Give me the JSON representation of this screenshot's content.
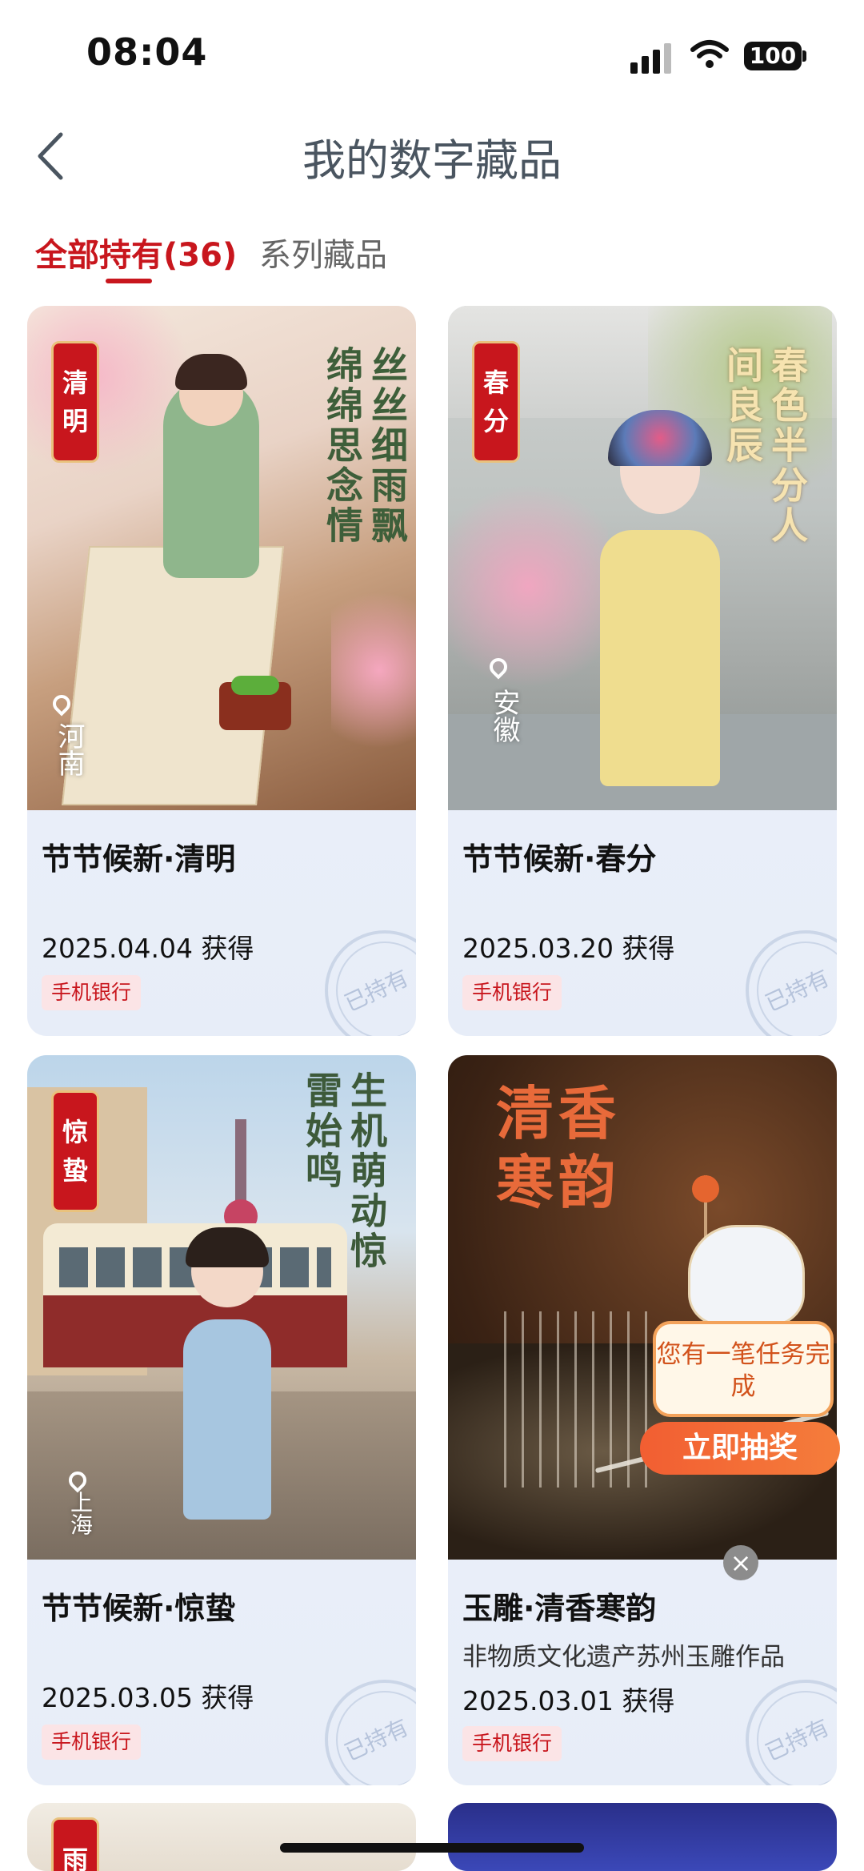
{
  "status_bar": {
    "time": "08:04",
    "battery": "100"
  },
  "header": {
    "title": "我的数字藏品"
  },
  "tabs": {
    "active": "全部持有(36)",
    "inactive": "系列藏品"
  },
  "cards": [
    {
      "name": "节节候新·清明",
      "date": "2025.04.04 获得",
      "tag": "手机银行",
      "stamp": "已持有",
      "badge": [
        "清",
        "明"
      ],
      "poem": "丝丝细雨飘绵绵思念情",
      "location": "河南"
    },
    {
      "name": "节节候新·春分",
      "date": "2025.03.20 获得",
      "tag": "手机银行",
      "stamp": "已持有",
      "badge": [
        "春",
        "分"
      ],
      "poem": "春色半分人间良辰",
      "location": "安徽"
    },
    {
      "name": "节节候新·惊蛰",
      "date": "2025.03.05 获得",
      "tag": "手机银行",
      "stamp": "已持有",
      "badge": [
        "惊",
        "蛰"
      ],
      "poem": "生机萌动惊雷始鸣",
      "location": "上海"
    },
    {
      "name": "玉雕·清香寒韵",
      "subtitle": "非物质文化遗产苏州玉雕作品",
      "date": "2025.03.01 获得",
      "tag": "手机银行",
      "stamp": "已持有",
      "art_title": "清香寒韵"
    }
  ],
  "next_card_badge": "雨",
  "popup": {
    "message": "您有一笔任务完成",
    "button": "立即抽奖"
  },
  "colors": {
    "accent": "#c8161d",
    "card_bg": "#eef2fb",
    "tag_bg": "#fbe4e6"
  }
}
